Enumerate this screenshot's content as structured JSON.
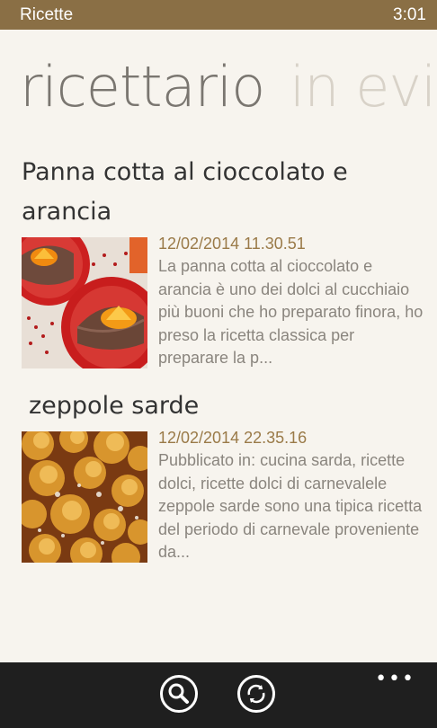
{
  "status": {
    "app_name": "Ricette",
    "time": "3:01"
  },
  "pivot": {
    "active": "ricettario",
    "next": "in evi"
  },
  "posts": [
    {
      "title": "Panna cotta al cioccolato e arancia",
      "date": "12/02/2014 11.30.51",
      "excerpt": "La panna cotta al cioccolato e arancia è uno dei dolci al cucchiaio più buoni che ho preparato finora, ho preso la ricetta classica per preparare la p...",
      "thumb_icon": "panna-cotta-photo"
    },
    {
      "title": "zeppole sarde",
      "date": "12/02/2014 22.35.16",
      "excerpt": "Pubblicato in: cucina sarda, ricette dolci, ricette dolci di carnevalele zeppole sarde sono una tipica ricetta del periodo di carnevale proveniente da...",
      "thumb_icon": "zeppole-photo"
    }
  ],
  "appbar": {
    "search_icon": "search-icon",
    "refresh_icon": "refresh-icon",
    "more": "•••"
  },
  "colors": {
    "accent": "#8a6f45",
    "background": "#f7f4ee",
    "appbar": "#1f1f1f"
  }
}
